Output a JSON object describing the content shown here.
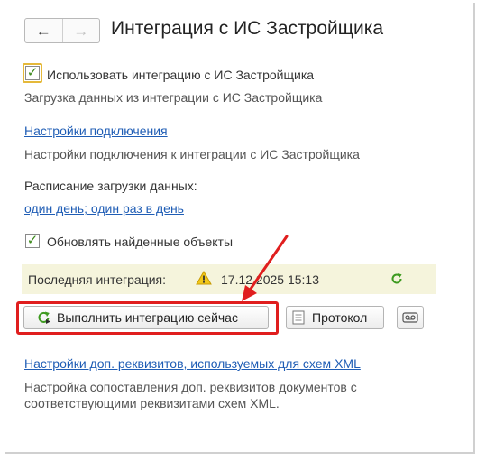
{
  "window": {
    "title": "Интеграция с ИС Застройщика"
  },
  "nav": {
    "back_icon": "arrow-left-icon",
    "forward_icon": "arrow-right-icon",
    "back_glyph": "←",
    "forward_glyph": "→"
  },
  "integration": {
    "checkbox_label": "Использовать интеграцию с ИС Застройщика",
    "checked": true,
    "description": "Загрузка данных из интеграции с ИС Застройщика"
  },
  "connection": {
    "link": "Настройки подключения",
    "description": "Настройки подключения к интеграции с ИС Застройщика"
  },
  "schedule": {
    "label": "Расписание загрузки данных:",
    "link": "один день; один раз в день"
  },
  "update": {
    "checkbox_label": "Обновлять найденные объекты",
    "checked": true
  },
  "last_integration": {
    "label": "Последняя интеграция:",
    "value": "17.12.2025 15:13",
    "status_icon": "warning-icon",
    "refresh_icon": "refresh-icon"
  },
  "buttons": {
    "run_now": "Выполнить интеграцию сейчас",
    "protocol": "Протокол",
    "tool_icon": "tape-icon"
  },
  "props": {
    "link": "Настройки доп. реквизитов, используемых для схем XML",
    "description": "Настройка сопоставления доп. реквизитов документов с соответствующими реквизитами схем XML."
  },
  "colors": {
    "accent_link": "#1f5db5",
    "check_green": "#3d8a1c",
    "highlight_red": "#e01e1e",
    "status_panel_bg": "#f5f4dc"
  }
}
